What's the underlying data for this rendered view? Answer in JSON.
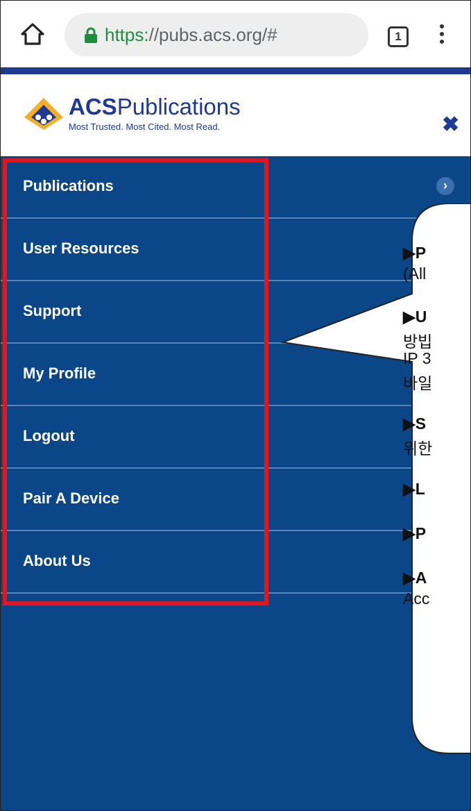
{
  "browser": {
    "url_scheme": "https:",
    "url_rest": "//pubs.acs.org/#",
    "tab_count": "1"
  },
  "header": {
    "brand_bold": "ACS",
    "brand_light": "Publications",
    "tagline": "Most Trusted. Most Cited. Most Read.",
    "close_icon": "✖"
  },
  "menu": {
    "items": [
      {
        "label": "Publications"
      },
      {
        "label": "User Resources"
      },
      {
        "label": "Support"
      },
      {
        "label": "My Profile"
      },
      {
        "label": "Logout"
      },
      {
        "label": "Pair A Device"
      },
      {
        "label": "About Us"
      }
    ],
    "expand_icon": "›"
  },
  "callout": {
    "lines": [
      {
        "text": "▶P",
        "bold": true
      },
      {
        "text": "(All",
        "bold": false
      },
      {
        "text": "▶U",
        "bold": true
      },
      {
        "text": "방빕",
        "bold": false
      },
      {
        "text": "IP 3",
        "bold": false
      },
      {
        "text": "바일",
        "bold": false
      },
      {
        "text": "▶S",
        "bold": true
      },
      {
        "text": "위한",
        "bold": false
      },
      {
        "text": "▶L",
        "bold": true
      },
      {
        "text": "▶P",
        "bold": true
      },
      {
        "text": "▶A",
        "bold": true
      },
      {
        "text": "Acc",
        "bold": false
      }
    ]
  },
  "colors": {
    "navy": "#0b4689",
    "brand_blue": "#1f3a93",
    "highlight_red": "#e6151b",
    "accent_yellow": "#f2c12e"
  }
}
